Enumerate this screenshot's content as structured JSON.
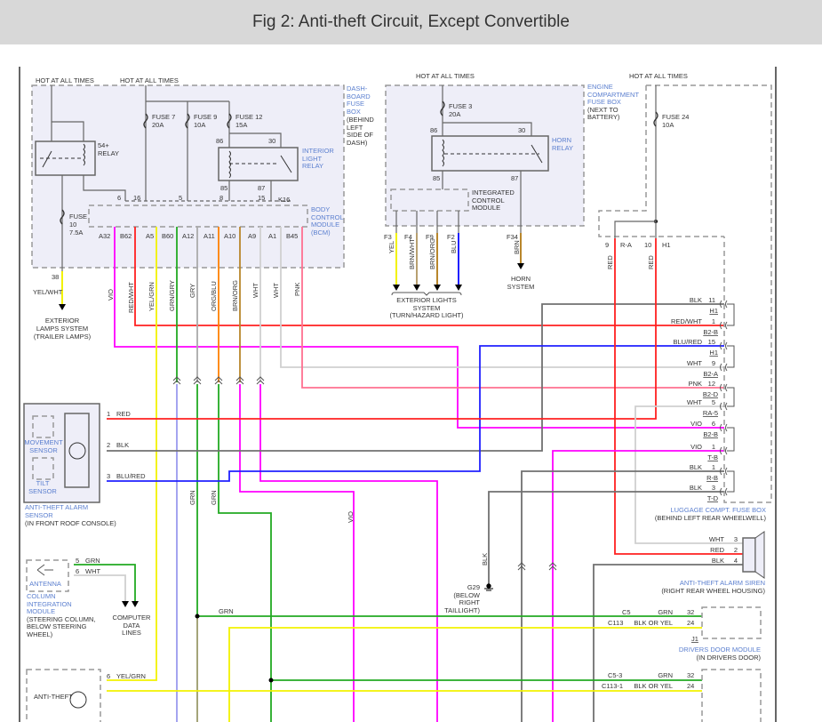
{
  "title": "Fig 2: Anti-theft Circuit, Except Convertible",
  "colors": {
    "vio": "#ff00ff",
    "red": "#ff2020",
    "yel": "#f2f200",
    "grn": "#22aa22",
    "gry": "#9a9a8a",
    "org": "#ff8000",
    "brn": "#b8862b",
    "wht": "#d0d0d0",
    "pnk": "#ff7090",
    "blk": "#707070",
    "blu": "#2020ff",
    "label_blue": "#5b7fcf"
  },
  "dash_fuse_box": {
    "hot1": "HOT AT ALL TIMES",
    "hot2": "HOT AT ALL TIMES",
    "name": [
      "DASH-",
      "BOARD",
      "FUSE",
      "BOX"
    ],
    "location": [
      "(BEHIND",
      "LEFT",
      "SIDE OF",
      "DASH)"
    ],
    "relay_54": [
      "54+",
      "RELAY"
    ],
    "fuses": [
      {
        "name": "FUSE 7",
        "rating": "20A"
      },
      {
        "name": "FUSE 9",
        "rating": "10A"
      },
      {
        "name": "FUSE 12",
        "rating": "15A"
      }
    ],
    "fuse10": [
      "FUSE",
      "10",
      "7.5A"
    ],
    "interior_relay": [
      "INTERIOR",
      "LIGHT",
      "RELAY"
    ],
    "relay_pins": {
      "p86": "86",
      "p30": "30",
      "p85": "85",
      "p87": "87"
    },
    "bcm_top_pins": [
      "6",
      "16",
      "5",
      "8",
      "15",
      "K16"
    ],
    "bcm": [
      "BODY",
      "CONTROL",
      "MODULE",
      "(BCM)"
    ],
    "bcm_pins": [
      "A32",
      "B62",
      "A5",
      "B60",
      "A12",
      "A11",
      "A10",
      "A9",
      "A1",
      "B45"
    ],
    "bcm_wires": [
      "VIO",
      "RED/WHT",
      "YEL/GRN",
      "GRN/GRY",
      "GRY",
      "ORG/BLU",
      "BRN/ORG",
      "WHT",
      "WHT",
      "PNK"
    ]
  },
  "exterior_lamps": {
    "pin": "38",
    "wire": "YEL/WHT",
    "label": [
      "EXTERIOR",
      "LAMPS SYSTEM",
      "(TRAILER LAMPS)"
    ]
  },
  "engine_fuse_box": {
    "hot": "HOT AT ALL TIMES",
    "name": [
      "ENGINE",
      "COMPARTMENT",
      "FUSE BOX"
    ],
    "location": [
      "(NEXT TO",
      "BATTERY)"
    ],
    "fuse3": {
      "name": "FUSE 3",
      "rating": "20A"
    },
    "horn_relay": [
      "HORN",
      "RELAY"
    ],
    "relay_pins": {
      "p86": "86",
      "p30": "30",
      "p85": "85",
      "p87": "87"
    },
    "icm": [
      "INTEGRATED",
      "CONTROL",
      "MODULE"
    ],
    "outputs": [
      {
        "pin": "F3",
        "wire": "YEL"
      },
      {
        "pin": "F4",
        "wire": "BRN/WHT"
      },
      {
        "pin": "F9",
        "wire": "BRN/ORG"
      },
      {
        "pin": "F2",
        "wire": "BLU"
      }
    ],
    "exterior_lights": [
      "EXTERIOR LIGHTS",
      "SYSTEM",
      "(TURN/HAZARD LIGHT)"
    ],
    "horn_pin": "F34",
    "horn_wire": "BRN",
    "horn_system": [
      "HORN",
      "SYSTEM"
    ]
  },
  "luggage_fuse_box": {
    "hot": "HOT AT ALL TIMES",
    "fuse24": {
      "name": "FUSE 24",
      "rating": "10A"
    },
    "inputs": [
      {
        "pin": "9",
        "conn": "R-A",
        "wire": "RED"
      },
      {
        "pin": "10",
        "conn": "H1",
        "wire": "RED"
      }
    ],
    "rows": [
      {
        "wire": "BLK",
        "pin": "11",
        "conn": "H1"
      },
      {
        "wire": "RED/WHT",
        "pin": "1",
        "conn": "B2-B"
      },
      {
        "wire": "BLU/RED",
        "pin": "15",
        "conn": "H1"
      },
      {
        "wire": "WHT",
        "pin": "9",
        "conn": "B2-A"
      },
      {
        "wire": "PNK",
        "pin": "12",
        "conn": "B2-D"
      },
      {
        "wire": "WHT",
        "pin": "5",
        "conn": "RA-5"
      },
      {
        "wire": "VIO",
        "pin": "6",
        "conn": "B2-B"
      },
      {
        "wire": "VIO",
        "pin": "1",
        "conn": "T-B"
      },
      {
        "wire": "BLK",
        "pin": "1",
        "conn": "R-B"
      },
      {
        "wire": "BLK",
        "pin": "3",
        "conn": "T-D"
      }
    ],
    "label": [
      "LUGGAGE COMPT. FUSE BOX",
      "(BEHIND LEFT REAR WHEELWELL)"
    ]
  },
  "alarm_sensor": {
    "movement": [
      "MOVEMENT",
      "SENSOR"
    ],
    "tilt": [
      "TILT",
      "SENSOR"
    ],
    "pins": [
      {
        "pin": "1",
        "wire": "RED"
      },
      {
        "pin": "2",
        "wire": "BLK"
      },
      {
        "pin": "3",
        "wire": "BLU/RED"
      }
    ],
    "label": [
      "ANTI-THEFT ALARM",
      "SENSOR",
      "(IN FRONT ROOF CONSOLE)"
    ]
  },
  "column_module": {
    "antenna": "ANTENNA",
    "pins": [
      {
        "pin": "5",
        "wire": "GRN"
      },
      {
        "pin": "6",
        "wire": "WHT"
      }
    ],
    "label": [
      "COLUMN",
      "INTEGRATION",
      "MODULE"
    ],
    "location": [
      "(STEERING COLUMN,",
      "BELOW STEERING",
      "WHEEL)"
    ],
    "data_lines": [
      "COMPUTER",
      "DATA",
      "LINES"
    ]
  },
  "mid_wires": {
    "grn1": "GRN",
    "grn2": "GRN",
    "vio": "VIO",
    "blk": "BLK",
    "grn_h": "GRN"
  },
  "ground": {
    "name": "G29",
    "location": [
      "(BELOW",
      "RIGHT",
      "TAILLIGHT)"
    ]
  },
  "siren": {
    "pins": [
      {
        "wire": "WHT",
        "pin": "3"
      },
      {
        "wire": "RED",
        "pin": "2"
      },
      {
        "wire": "BLK",
        "pin": "4"
      }
    ],
    "label": [
      "ANTI-THEFT ALARM SIREN",
      "(RIGHT REAR WHEEL HOUSING)"
    ]
  },
  "drivers_door_module": {
    "rows": [
      {
        "conn": "C5",
        "wire": "GRN",
        "pin": "32"
      },
      {
        "conn": "C113",
        "wire": "BLK OR YEL",
        "pin": "24"
      }
    ],
    "connector": "J1",
    "label": [
      "DRIVERS DOOR MODULE",
      "(IN DRIVERS DOOR)"
    ]
  },
  "second_door_module": {
    "rows": [
      {
        "conn": "C5-3",
        "wire": "GRN",
        "pin": "32"
      },
      {
        "conn": "C113-1",
        "wire": "BLK OR YEL",
        "pin": "24"
      }
    ]
  },
  "bottom_module": {
    "pin": "6",
    "wire": "YEL/GRN",
    "label": "ANTI-THEFT"
  }
}
